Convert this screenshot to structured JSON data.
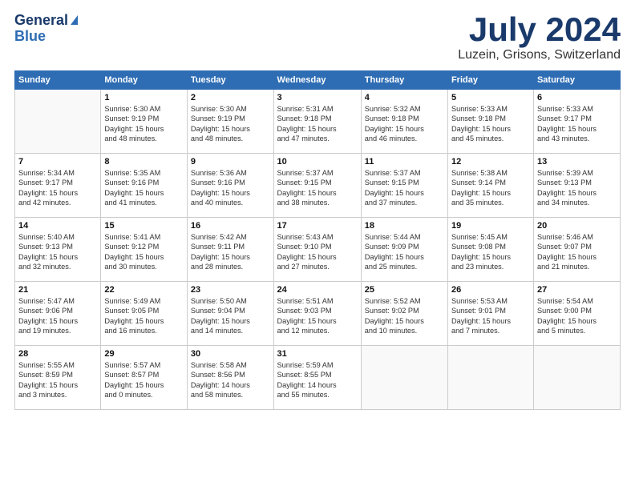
{
  "logo": {
    "line1": "General",
    "line2": "Blue"
  },
  "header": {
    "month": "July 2024",
    "location": "Luzein, Grisons, Switzerland"
  },
  "weekdays": [
    "Sunday",
    "Monday",
    "Tuesday",
    "Wednesday",
    "Thursday",
    "Friday",
    "Saturday"
  ],
  "weeks": [
    [
      {
        "num": "",
        "info": ""
      },
      {
        "num": "1",
        "info": "Sunrise: 5:30 AM\nSunset: 9:19 PM\nDaylight: 15 hours\nand 48 minutes."
      },
      {
        "num": "2",
        "info": "Sunrise: 5:30 AM\nSunset: 9:19 PM\nDaylight: 15 hours\nand 48 minutes."
      },
      {
        "num": "3",
        "info": "Sunrise: 5:31 AM\nSunset: 9:18 PM\nDaylight: 15 hours\nand 47 minutes."
      },
      {
        "num": "4",
        "info": "Sunrise: 5:32 AM\nSunset: 9:18 PM\nDaylight: 15 hours\nand 46 minutes."
      },
      {
        "num": "5",
        "info": "Sunrise: 5:33 AM\nSunset: 9:18 PM\nDaylight: 15 hours\nand 45 minutes."
      },
      {
        "num": "6",
        "info": "Sunrise: 5:33 AM\nSunset: 9:17 PM\nDaylight: 15 hours\nand 43 minutes."
      }
    ],
    [
      {
        "num": "7",
        "info": "Sunrise: 5:34 AM\nSunset: 9:17 PM\nDaylight: 15 hours\nand 42 minutes."
      },
      {
        "num": "8",
        "info": "Sunrise: 5:35 AM\nSunset: 9:16 PM\nDaylight: 15 hours\nand 41 minutes."
      },
      {
        "num": "9",
        "info": "Sunrise: 5:36 AM\nSunset: 9:16 PM\nDaylight: 15 hours\nand 40 minutes."
      },
      {
        "num": "10",
        "info": "Sunrise: 5:37 AM\nSunset: 9:15 PM\nDaylight: 15 hours\nand 38 minutes."
      },
      {
        "num": "11",
        "info": "Sunrise: 5:37 AM\nSunset: 9:15 PM\nDaylight: 15 hours\nand 37 minutes."
      },
      {
        "num": "12",
        "info": "Sunrise: 5:38 AM\nSunset: 9:14 PM\nDaylight: 15 hours\nand 35 minutes."
      },
      {
        "num": "13",
        "info": "Sunrise: 5:39 AM\nSunset: 9:13 PM\nDaylight: 15 hours\nand 34 minutes."
      }
    ],
    [
      {
        "num": "14",
        "info": "Sunrise: 5:40 AM\nSunset: 9:13 PM\nDaylight: 15 hours\nand 32 minutes."
      },
      {
        "num": "15",
        "info": "Sunrise: 5:41 AM\nSunset: 9:12 PM\nDaylight: 15 hours\nand 30 minutes."
      },
      {
        "num": "16",
        "info": "Sunrise: 5:42 AM\nSunset: 9:11 PM\nDaylight: 15 hours\nand 28 minutes."
      },
      {
        "num": "17",
        "info": "Sunrise: 5:43 AM\nSunset: 9:10 PM\nDaylight: 15 hours\nand 27 minutes."
      },
      {
        "num": "18",
        "info": "Sunrise: 5:44 AM\nSunset: 9:09 PM\nDaylight: 15 hours\nand 25 minutes."
      },
      {
        "num": "19",
        "info": "Sunrise: 5:45 AM\nSunset: 9:08 PM\nDaylight: 15 hours\nand 23 minutes."
      },
      {
        "num": "20",
        "info": "Sunrise: 5:46 AM\nSunset: 9:07 PM\nDaylight: 15 hours\nand 21 minutes."
      }
    ],
    [
      {
        "num": "21",
        "info": "Sunrise: 5:47 AM\nSunset: 9:06 PM\nDaylight: 15 hours\nand 19 minutes."
      },
      {
        "num": "22",
        "info": "Sunrise: 5:49 AM\nSunset: 9:05 PM\nDaylight: 15 hours\nand 16 minutes."
      },
      {
        "num": "23",
        "info": "Sunrise: 5:50 AM\nSunset: 9:04 PM\nDaylight: 15 hours\nand 14 minutes."
      },
      {
        "num": "24",
        "info": "Sunrise: 5:51 AM\nSunset: 9:03 PM\nDaylight: 15 hours\nand 12 minutes."
      },
      {
        "num": "25",
        "info": "Sunrise: 5:52 AM\nSunset: 9:02 PM\nDaylight: 15 hours\nand 10 minutes."
      },
      {
        "num": "26",
        "info": "Sunrise: 5:53 AM\nSunset: 9:01 PM\nDaylight: 15 hours\nand 7 minutes."
      },
      {
        "num": "27",
        "info": "Sunrise: 5:54 AM\nSunset: 9:00 PM\nDaylight: 15 hours\nand 5 minutes."
      }
    ],
    [
      {
        "num": "28",
        "info": "Sunrise: 5:55 AM\nSunset: 8:59 PM\nDaylight: 15 hours\nand 3 minutes."
      },
      {
        "num": "29",
        "info": "Sunrise: 5:57 AM\nSunset: 8:57 PM\nDaylight: 15 hours\nand 0 minutes."
      },
      {
        "num": "30",
        "info": "Sunrise: 5:58 AM\nSunset: 8:56 PM\nDaylight: 14 hours\nand 58 minutes."
      },
      {
        "num": "31",
        "info": "Sunrise: 5:59 AM\nSunset: 8:55 PM\nDaylight: 14 hours\nand 55 minutes."
      },
      {
        "num": "",
        "info": ""
      },
      {
        "num": "",
        "info": ""
      },
      {
        "num": "",
        "info": ""
      }
    ]
  ]
}
